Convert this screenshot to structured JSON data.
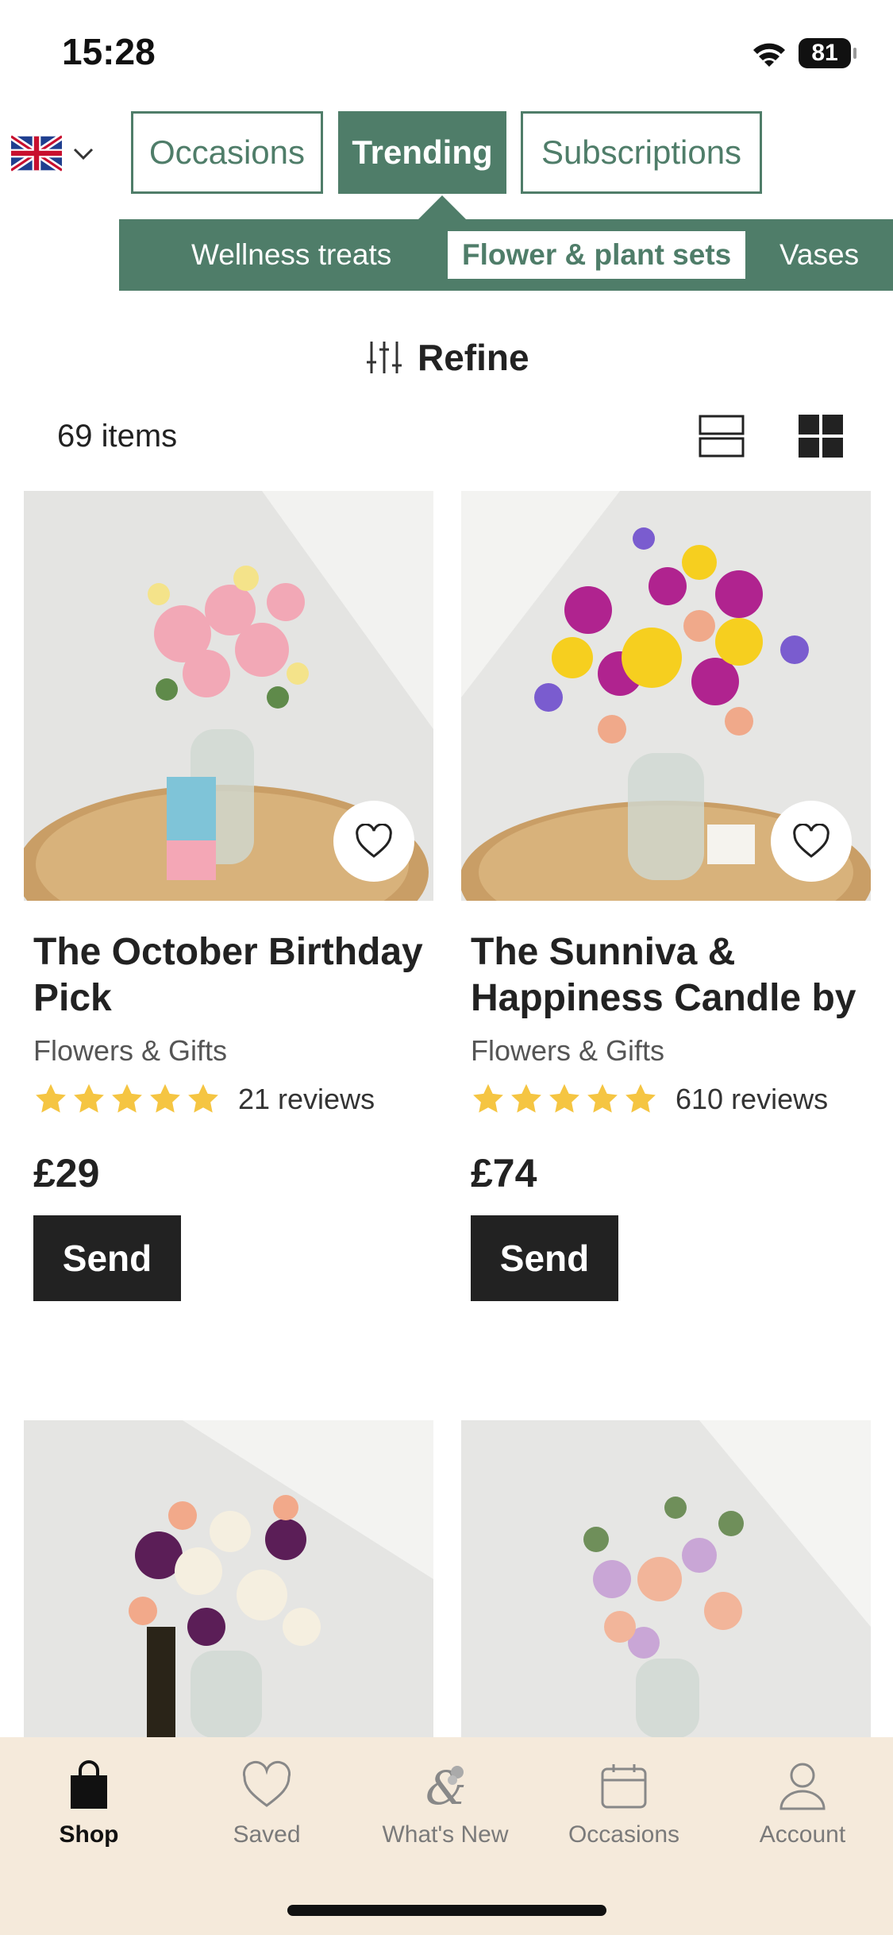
{
  "status_bar": {
    "time": "15:28",
    "battery": "81"
  },
  "header": {
    "country_icon": "uk-flag-icon",
    "tabs": [
      {
        "label": "Occasions",
        "active": false
      },
      {
        "label": "Trending",
        "active": true
      },
      {
        "label": "Subscriptions",
        "active": false
      }
    ],
    "subnav": [
      {
        "label": "Wellness treats",
        "active": false
      },
      {
        "label": "Flower & plant sets",
        "active": true
      },
      {
        "label": "Vases",
        "active": false
      }
    ]
  },
  "toolbar": {
    "refine_label": "Refine",
    "item_count": "69 items"
  },
  "products": [
    {
      "title": "The October Birthday Pick",
      "category": "Flowers & Gifts",
      "rating": 5,
      "reviews": "21 reviews",
      "price": "£29",
      "cta": "Send"
    },
    {
      "title": "The Sunniva & Happiness Candle by",
      "category": "Flowers & Gifts",
      "rating": 5,
      "reviews": "610 reviews",
      "price": "£74",
      "cta": "Send"
    }
  ],
  "bottom_nav": [
    {
      "label": "Shop",
      "icon": "shopping-bag-icon",
      "active": true
    },
    {
      "label": "Saved",
      "icon": "heart-icon",
      "active": false
    },
    {
      "label": "What's New",
      "icon": "ampersand-flower-icon",
      "active": false
    },
    {
      "label": "Occasions",
      "icon": "calendar-icon",
      "active": false
    },
    {
      "label": "Account",
      "icon": "person-icon",
      "active": false
    }
  ],
  "colors": {
    "brand_green": "#4f7d69",
    "star": "#f5c542",
    "nav_bg": "#f5eadb",
    "button": "#222222"
  }
}
